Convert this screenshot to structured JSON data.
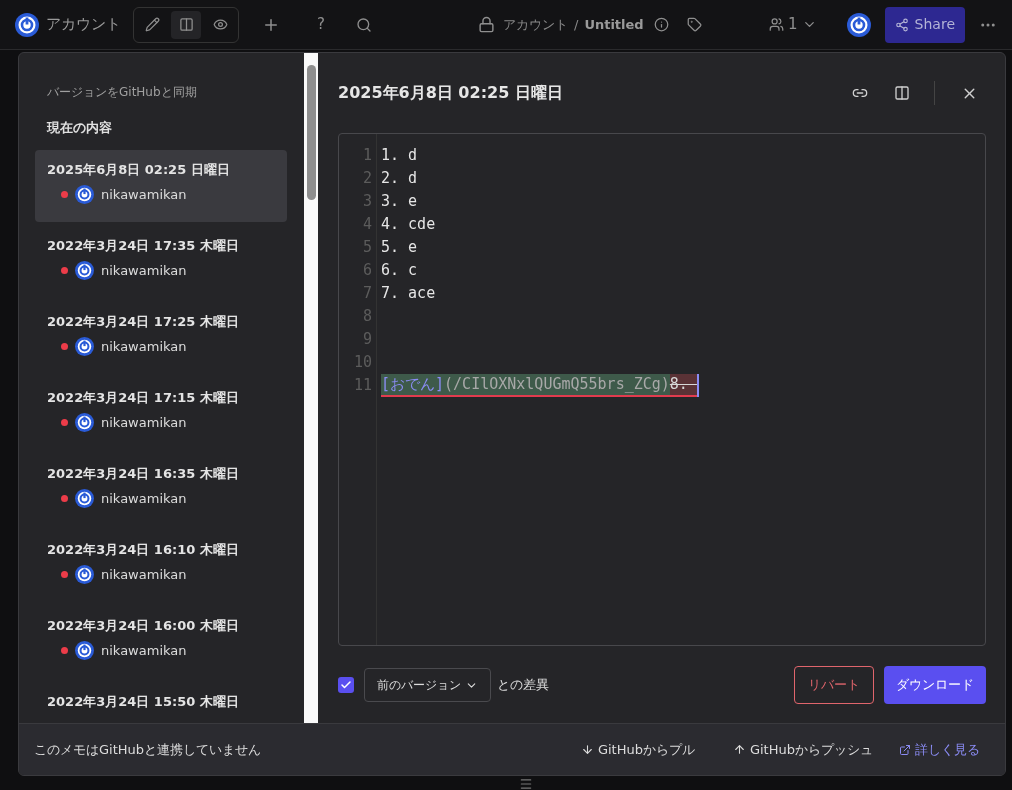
{
  "topbar": {
    "title": "アカウント",
    "modes": [
      {
        "kind": "edit",
        "selected": false
      },
      {
        "kind": "split",
        "selected": true
      },
      {
        "kind": "view",
        "selected": false
      }
    ],
    "breadcrumb": {
      "folder": "アカウント",
      "separator": "/",
      "note": "Untitled"
    },
    "help": "?",
    "online_count": "1",
    "share": "Share"
  },
  "dialog": {
    "sidebar": {
      "sync_label": "バージョンをGitHubと同期",
      "current_label": "現在の内容",
      "versions": [
        {
          "date": "2025年6月8日 02:25 日曜日",
          "user": "nikawamikan",
          "selected": true
        },
        {
          "date": "2022年3月24日 17:35 木曜日",
          "user": "nikawamikan",
          "selected": false
        },
        {
          "date": "2022年3月24日 17:25 木曜日",
          "user": "nikawamikan",
          "selected": false
        },
        {
          "date": "2022年3月24日 17:15 木曜日",
          "user": "nikawamikan",
          "selected": false
        },
        {
          "date": "2022年3月24日 16:35 木曜日",
          "user": "nikawamikan",
          "selected": false
        },
        {
          "date": "2022年3月24日 16:10 木曜日",
          "user": "nikawamikan",
          "selected": false
        },
        {
          "date": "2022年3月24日 16:00 木曜日",
          "user": "nikawamikan",
          "selected": false
        },
        {
          "date": "2022年3月24日 15:50 木曜日",
          "selected": false
        }
      ]
    },
    "title": "2025年6月8日 02:25 日曜日",
    "code_lines": [
      {
        "number": "1",
        "segments": [
          {
            "text": "1. d",
            "kind": "plain"
          }
        ]
      },
      {
        "number": "2",
        "segments": [
          {
            "text": "2. d",
            "kind": "plain"
          }
        ]
      },
      {
        "number": "3",
        "segments": [
          {
            "text": "3. e",
            "kind": "plain"
          }
        ]
      },
      {
        "number": "4",
        "segments": [
          {
            "text": "4. cde",
            "kind": "plain"
          }
        ]
      },
      {
        "number": "5",
        "segments": [
          {
            "text": "5. e",
            "kind": "plain"
          }
        ]
      },
      {
        "number": "6",
        "segments": [
          {
            "text": "6. c",
            "kind": "plain"
          }
        ]
      },
      {
        "number": "7",
        "segments": [
          {
            "text": "7. ace",
            "kind": "plain"
          }
        ]
      },
      {
        "number": "8"
      },
      {
        "number": "9"
      },
      {
        "number": "10"
      },
      {
        "number": "11",
        "segments": [
          {
            "text": "[おでん]",
            "kind": "added-link"
          },
          {
            "text": "(/CIlOXNxlQUGmQ55brs_ZCg)",
            "kind": "added"
          },
          {
            "text": "8. ",
            "kind": "removed"
          }
        ]
      }
    ],
    "diff": {
      "checked": true,
      "compare": "前のバージョン",
      "suffix": "との差異"
    },
    "revert": "リバート",
    "download": "ダウンロード",
    "footer": {
      "status": "このメモはGitHubと連携していません",
      "pull": "GitHubからプル",
      "push": "GitHubからプッシュ",
      "learn_more": "詳しく見る"
    }
  }
}
